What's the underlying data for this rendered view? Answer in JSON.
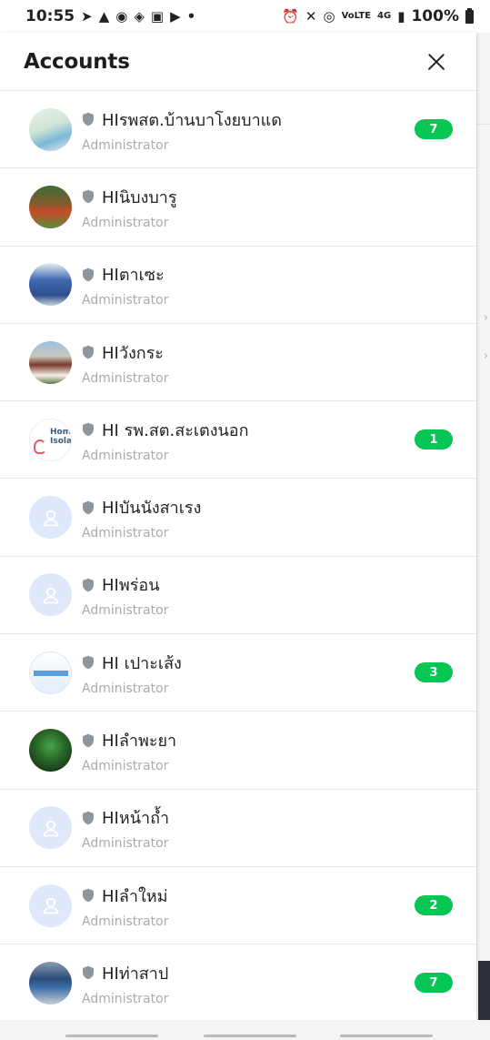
{
  "status_bar": {
    "time": "10:55",
    "network": "4G",
    "volte": "VoLTE",
    "battery": "100%"
  },
  "panel": {
    "title": "Accounts"
  },
  "accounts": [
    {
      "name": "HIรพสต.บ้านบาโงยบาแด",
      "role": "Administrator",
      "badge": "7"
    },
    {
      "name": "HIนิบงบารู",
      "role": "Administrator",
      "badge": ""
    },
    {
      "name": "HIตาเซะ",
      "role": "Administrator",
      "badge": ""
    },
    {
      "name": "HIวังกระ",
      "role": "Administrator",
      "badge": ""
    },
    {
      "name": "HI รพ.สต.สะเตงนอก",
      "role": "Administrator",
      "badge": "1",
      "avatar_text": "Hom Isolati"
    },
    {
      "name": "HIบันนังสาเรง",
      "role": "Administrator",
      "badge": ""
    },
    {
      "name": "HIพร่อน",
      "role": "Administrator",
      "badge": ""
    },
    {
      "name": "HI เปาะเส้ง",
      "role": "Administrator",
      "badge": "3"
    },
    {
      "name": "HIลำพะยา",
      "role": "Administrator",
      "badge": ""
    },
    {
      "name": "HIหน้าถ้ำ",
      "role": "Administrator",
      "badge": ""
    },
    {
      "name": "HIลำใหม่",
      "role": "Administrator",
      "badge": "2"
    },
    {
      "name": "HIท่าสาป",
      "role": "Administrator",
      "badge": "7"
    }
  ],
  "colors": {
    "badge": "#06c755",
    "default_avatar_bg": "#dfe8fb",
    "role_text": "#a7abb1"
  }
}
